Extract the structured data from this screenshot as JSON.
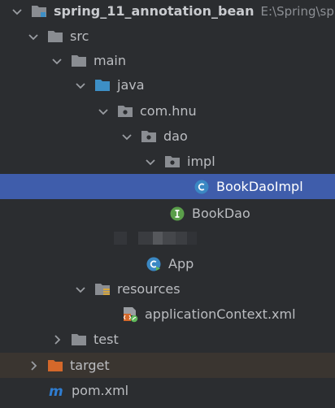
{
  "tree": {
    "project": {
      "name": "spring_11_annotation_bean",
      "path": "E:\\Spring\\spri"
    },
    "src": "src",
    "main": "main",
    "java": "java",
    "package": "com.hnu",
    "dao": "dao",
    "impl": "impl",
    "book_dao_impl": "BookDaoImpl",
    "book_dao": "BookDao",
    "app": "App",
    "resources": "resources",
    "app_context": "applicationContext.xml",
    "test": "test",
    "target": "target",
    "pom": "pom.xml"
  },
  "colors": {
    "background": "#2b2d30",
    "selection": "#3f5dab",
    "folder": "#8a8d92",
    "source_folder": "#3d8fc6",
    "excluded_folder": "#d4682a",
    "class_icon": "#3b88c3",
    "interface_icon": "#5a9e4a",
    "maven": "#2f7dd1"
  },
  "icons": {
    "folder": "folder-icon",
    "source_root": "source-folder-icon",
    "package": "package-icon",
    "class": "class-icon",
    "interface": "interface-icon",
    "app_class": "app-class-icon",
    "resources": "resources-folder-icon",
    "xml": "spring-xml-icon",
    "excluded": "excluded-folder-icon",
    "maven": "maven-icon"
  }
}
